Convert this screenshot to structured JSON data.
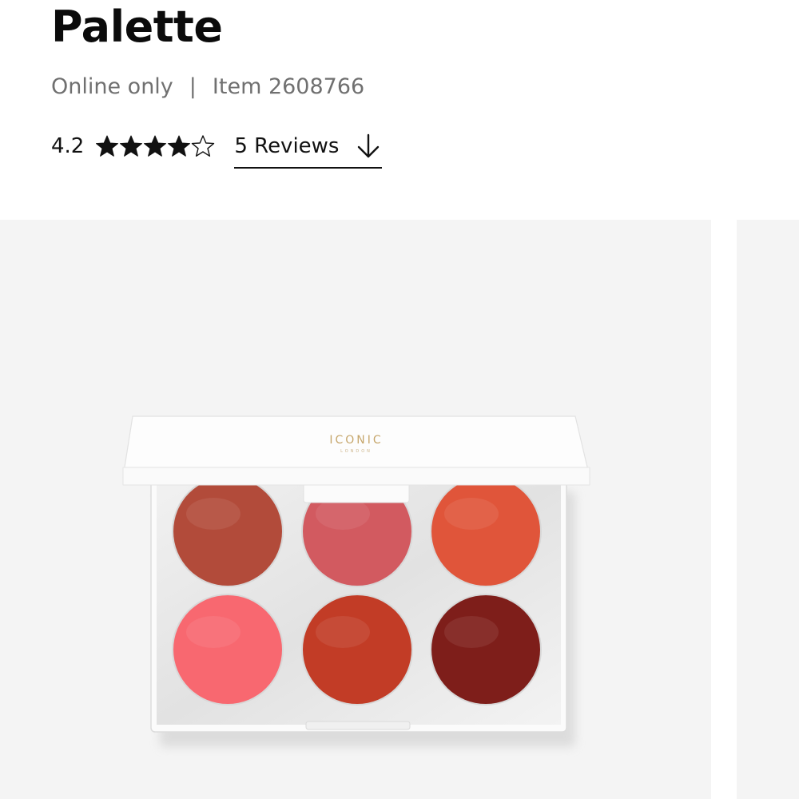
{
  "product": {
    "title": "Palette",
    "availability": "Online only",
    "separator": "|",
    "item_number": "Item 2608766",
    "rating_value": "4.2",
    "rating": 4.2,
    "rating_max": 5,
    "reviews_label": "5 Reviews",
    "brand_logo_text": "ICONIC"
  },
  "gallery": {
    "swatch_colors": [
      "#b24b3a",
      "#d25a60",
      "#e0553a",
      "#f86870",
      "#c23c26",
      "#7e1e1a"
    ]
  },
  "icons": {
    "star_filled": "star-filled-icon",
    "star_empty": "star-outline-icon",
    "reviews_arrow": "arrow-down-icon"
  }
}
